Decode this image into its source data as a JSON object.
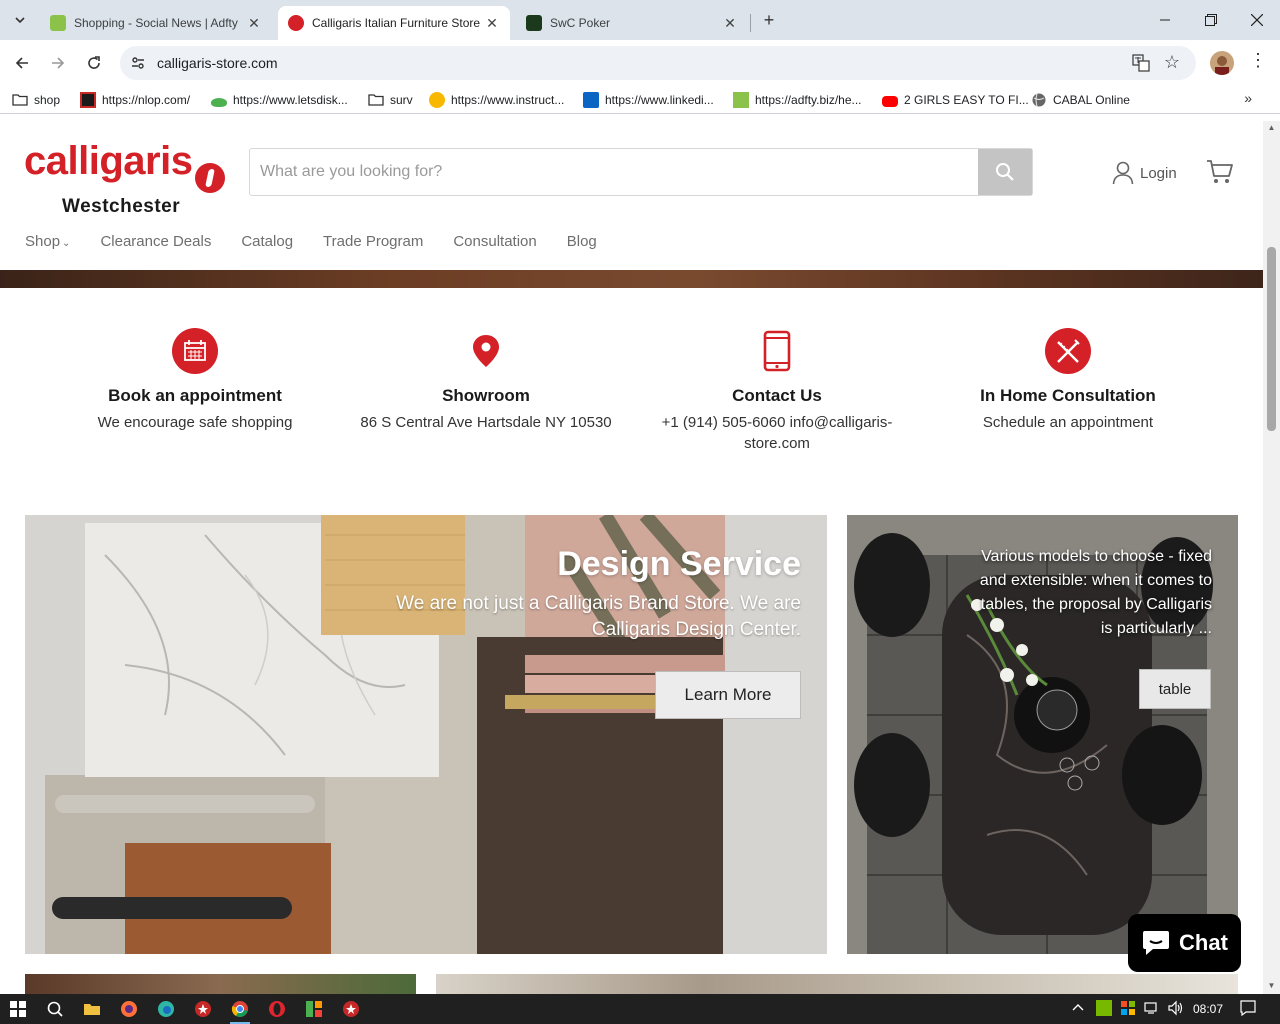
{
  "browser": {
    "tabs": [
      {
        "title": "Shopping - Social News | Adfty",
        "active": false
      },
      {
        "title": "Calligaris Italian Furniture Store",
        "active": true
      },
      {
        "title": "SwC Poker",
        "active": false
      }
    ],
    "url": "calligaris-store.com",
    "bookmarks": [
      {
        "label": "shop"
      },
      {
        "label": "https://nlop.com/"
      },
      {
        "label": "https://www.letsdisk..."
      },
      {
        "label": "surv"
      },
      {
        "label": "https://www.instruct..."
      },
      {
        "label": "https://www.linkedi..."
      },
      {
        "label": "https://adfty.biz/he..."
      },
      {
        "label": "2 GIRLS EASY TO FI..."
      },
      {
        "label": "CABAL Online"
      }
    ]
  },
  "header": {
    "logo_word": "calligaris",
    "logo_sub": "Westchester",
    "search_placeholder": "What are you looking for?",
    "login_label": "Login"
  },
  "nav": {
    "shop": "Shop",
    "items": [
      "Clearance Deals",
      "Catalog",
      "Trade Program",
      "Consultation",
      "Blog"
    ]
  },
  "features": [
    {
      "title": "Book an appointment",
      "desc": "We encourage safe shopping",
      "icon": "calendar-icon"
    },
    {
      "title": "Showroom",
      "desc": "86 S Central Ave Hartsdale NY 10530",
      "icon": "location-pin-icon"
    },
    {
      "title": "Contact Us",
      "desc": "+1 (914) 505-6060 info@calligaris-store.com",
      "icon": "phone-icon"
    },
    {
      "title": "In Home Consultation",
      "desc": "Schedule an appointment",
      "icon": "ruler-pencil-icon"
    }
  ],
  "promo_left": {
    "title": "Design Service",
    "desc": "We are not just a Calligaris Brand Store. We are Calligaris Design Center.",
    "button": "Learn More"
  },
  "promo_right": {
    "desc": "Various models to choose - fixed and extensible: when it comes to tables, the proposal by Calligaris is particularly ...",
    "button": "table"
  },
  "chat": {
    "label": "Chat"
  },
  "taskbar": {
    "time": "08:07"
  },
  "colors": {
    "brand": "#d42027"
  }
}
